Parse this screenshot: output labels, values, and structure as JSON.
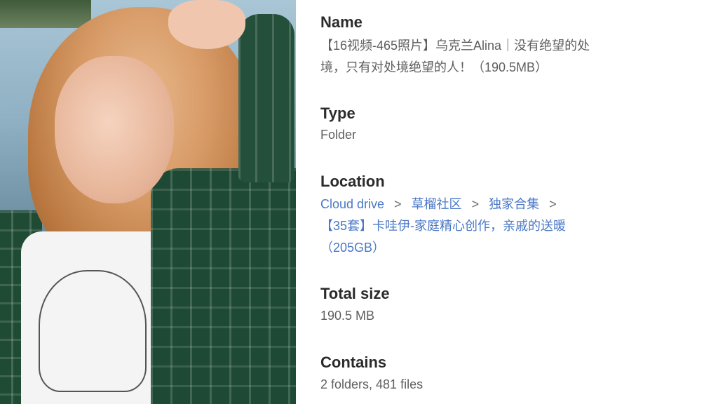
{
  "details": {
    "name_label": "Name",
    "name_value_line1": "【16视频-465照片】乌克兰Alina｜没有绝望的处",
    "name_value_line2": "境，只有对处境绝望的人！（190.5MB）",
    "type_label": "Type",
    "type_value": "Folder",
    "location_label": "Location",
    "location_path": [
      "Cloud drive",
      "草榴社区",
      "独家合集",
      "【35套】卡哇伊-家庭精心创作，亲戚的送暖",
      "（205GB）"
    ],
    "breadcrumb_separator": ">",
    "total_size_label": "Total size",
    "total_size_value": "190.5 MB",
    "contains_label": "Contains",
    "contains_value": "2 folders, 481 files"
  },
  "colors": {
    "label_text": "#2b2b2b",
    "value_text": "#5f5f5f",
    "link_text": "#4a78c6",
    "background": "#ffffff"
  }
}
